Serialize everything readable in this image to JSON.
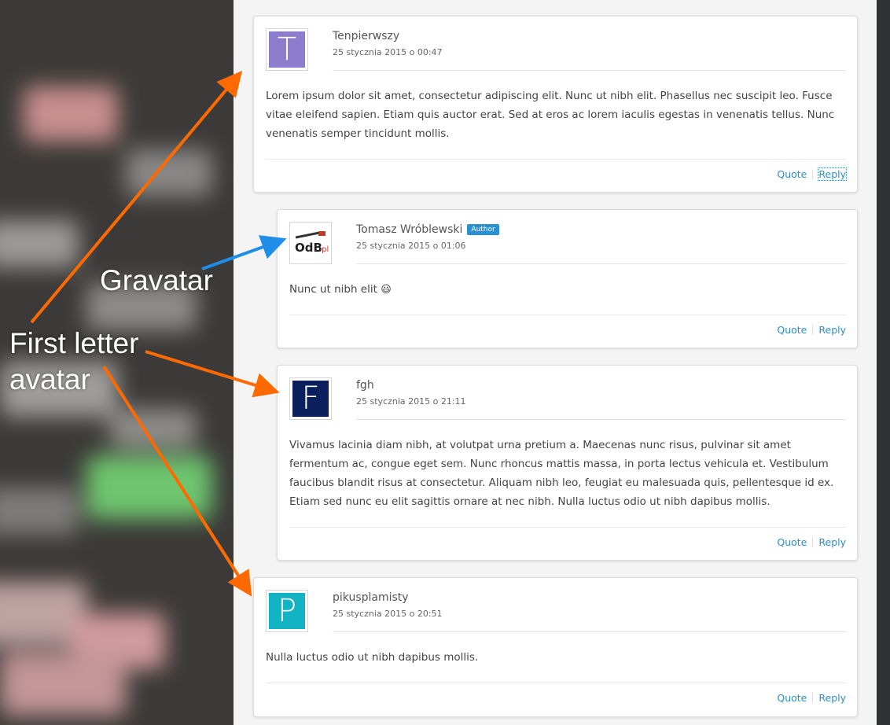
{
  "colors": {
    "link": "#2e8fc6",
    "arrow_orange": "#ff6a00",
    "arrow_blue": "#1e8ee8",
    "badge": "#2a8fcf"
  },
  "annotations": {
    "gravatar": "Gravatar",
    "first_letter_line1": "First letter",
    "first_letter_line2": "avatar"
  },
  "comments": [
    {
      "author": "Tenpierwszy",
      "date": "25 stycznia 2015 o 00:47",
      "avatar_letter": "T",
      "avatar_color": "#8e7ccc",
      "text": "Lorem ipsum dolor sit amet, consectetur adipiscing elit. Nunc ut nibh elit. Phasellus nec suscipit leo. Fusce vitae eleifend sapien. Etiam quis auctor erat. Sed at eros ac lorem iaculis egestas in venenatis tellus. Nunc venenatis semper tincidunt mollis.",
      "quote": "Quote",
      "reply": "Reply"
    },
    {
      "author": "Tomasz Wróblewski",
      "badge": "Author",
      "date": "25 stycznia 2015 o 01:06",
      "avatar_logo": "OdB.pl",
      "text": "Nunc ut nibh elit",
      "emoji": "😃",
      "quote": "Quote",
      "reply": "Reply"
    },
    {
      "author": "fgh",
      "date": "25 stycznia 2015 o 21:11",
      "avatar_letter": "F",
      "avatar_color": "#0b1f5c",
      "text": "Vivamus lacinia diam nibh, at volutpat urna pretium a. Maecenas nunc risus, pulvinar sit amet fermentum ac, congue eget sem. Nunc rhoncus mattis massa, in porta lectus vehicula et. Vestibulum faucibus blandit risus at consectetur. Aliquam nibh leo, feugiat eu malesuada quis, pellentesque id ex. Etiam sed nunc eu elit sagittis ornare at nec nibh. Nulla luctus odio ut nibh dapibus mollis.",
      "quote": "Quote",
      "reply": "Reply"
    },
    {
      "author": "pikusplamisty",
      "date": "25 stycznia 2015 o 20:51",
      "avatar_letter": "P",
      "avatar_color": "#12b4c4",
      "text": "Nulla luctus odio ut nibh dapibus mollis.",
      "quote": "Quote",
      "reply": "Reply"
    }
  ]
}
